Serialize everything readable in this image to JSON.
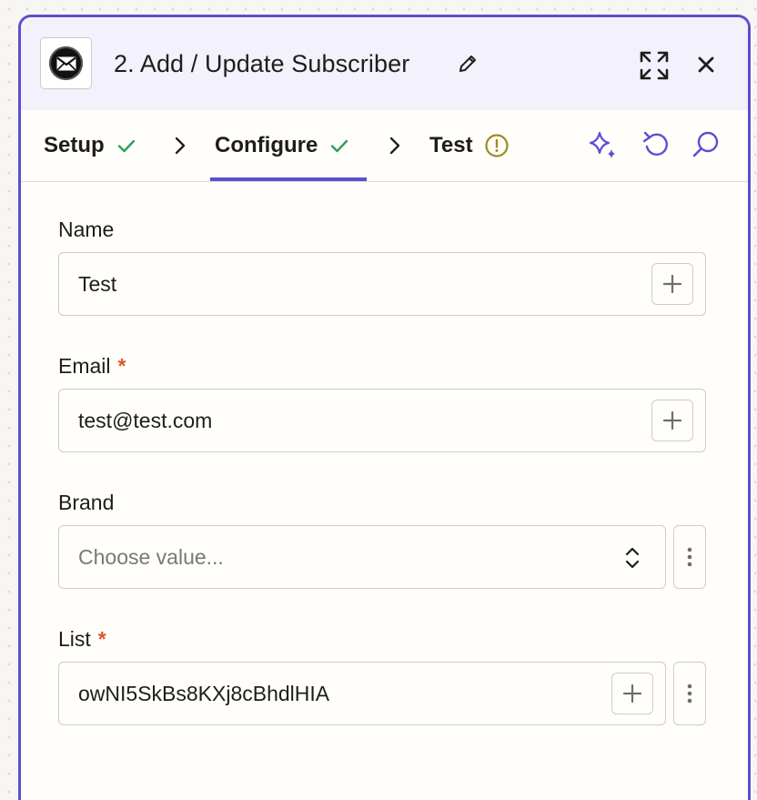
{
  "header": {
    "title": "2. Add / Update Subscriber",
    "app_icon": "envelope-icon",
    "actions": [
      "edit-icon",
      "expand-icon",
      "close-icon"
    ]
  },
  "tabs": [
    {
      "label": "Setup",
      "status": "complete"
    },
    {
      "label": "Configure",
      "status": "complete",
      "active": true
    },
    {
      "label": "Test",
      "status": "warning"
    }
  ],
  "toolbar": {
    "icons": [
      "sparkle-icon",
      "undo-icon",
      "search-icon"
    ]
  },
  "colors": {
    "accent": "#5b4fcf",
    "success": "#2e9e5b",
    "warning": "#a08a1e",
    "required": "#e0562e"
  },
  "form": {
    "name": {
      "label": "Name",
      "value": "Test",
      "required": false
    },
    "email": {
      "label": "Email",
      "value": "test@test.com",
      "required": true
    },
    "brand": {
      "label": "Brand",
      "placeholder": "Choose value...",
      "required": false
    },
    "list": {
      "label": "List",
      "value": "owNI5SkBs8KXj8cBhdlHIA",
      "required": true
    },
    "required_marker": "*"
  }
}
